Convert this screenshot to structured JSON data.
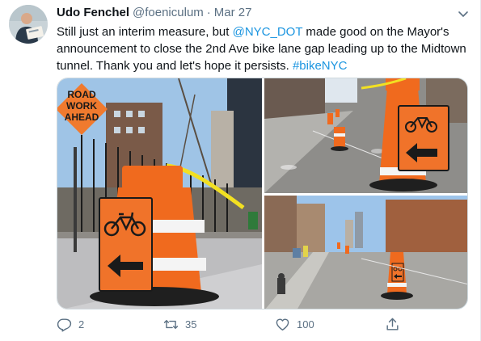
{
  "tweet": {
    "author_name": "Udo Fenchel",
    "author_handle": "@foeniculum",
    "separator": "·",
    "timestamp": "Mar 27",
    "text_parts": {
      "t1": "Still just an interim measure, but ",
      "mention": "@NYC_DOT",
      "t2": " made good on the Mayor's announcement to close the 2nd Ave bike lane gap leading up to the Midtown tunnel. Thank you and let's hope it persists. ",
      "hashtag": "#bikeNYC"
    },
    "photos": {
      "p1": {
        "sign_line1": "ROAD",
        "sign_line2": "WORK",
        "sign_line3": "AHEAD"
      }
    },
    "actions": {
      "reply_count": "2",
      "retweet_count": "35",
      "like_count": "100"
    }
  },
  "colors": {
    "link": "#1b95e0",
    "secondary_text": "#5b7083",
    "cone_orange": "#f06a1e",
    "sign_orange": "#f0732a"
  },
  "icons": {
    "caret": "chevron-down-icon",
    "reply": "reply-icon",
    "retweet": "retweet-icon",
    "like": "heart-icon",
    "share": "share-icon"
  }
}
